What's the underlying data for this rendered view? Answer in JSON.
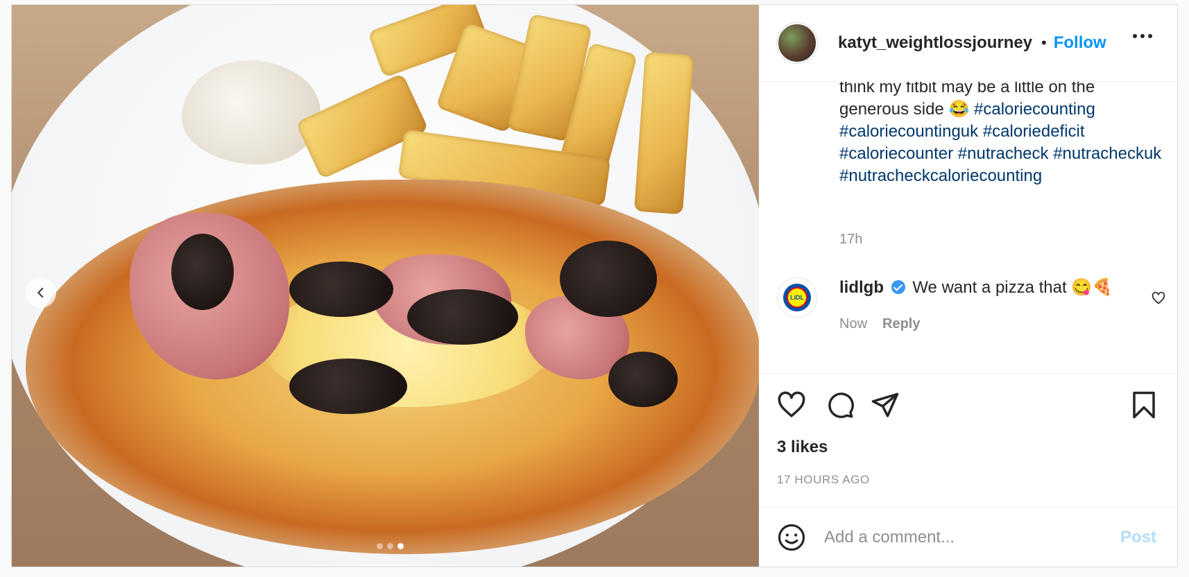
{
  "header": {
    "username": "katyt_weightlossjourney",
    "separator": "•",
    "follow_label": "Follow"
  },
  "caption": {
    "text_start": "think my fitbit may be a little on the generous side 😂",
    "hashtags": [
      "#caloriecounting",
      "#caloriecountinguk",
      "#caloriedeficit",
      "#caloriecounter",
      "#nutracheck",
      "#nutracheckuk",
      "#nutracheckcaloriecounting"
    ],
    "time": "17h"
  },
  "comment": {
    "username": "lidlgb",
    "text": "We want a pizza that 😋🍕",
    "time": "Now",
    "reply_label": "Reply",
    "avatar_text": "LiDL"
  },
  "likes": "3 likes",
  "posted_ago": "17 HOURS AGO",
  "add_comment": {
    "placeholder": "Add a comment...",
    "post_label": "Post"
  },
  "carousel": {
    "slide_count": 3,
    "active_index": 2
  },
  "colors": {
    "accent": "#0095f6",
    "hashtag": "#00376b",
    "muted": "#8e8e8e",
    "post_disabled": "#b2dffc"
  }
}
